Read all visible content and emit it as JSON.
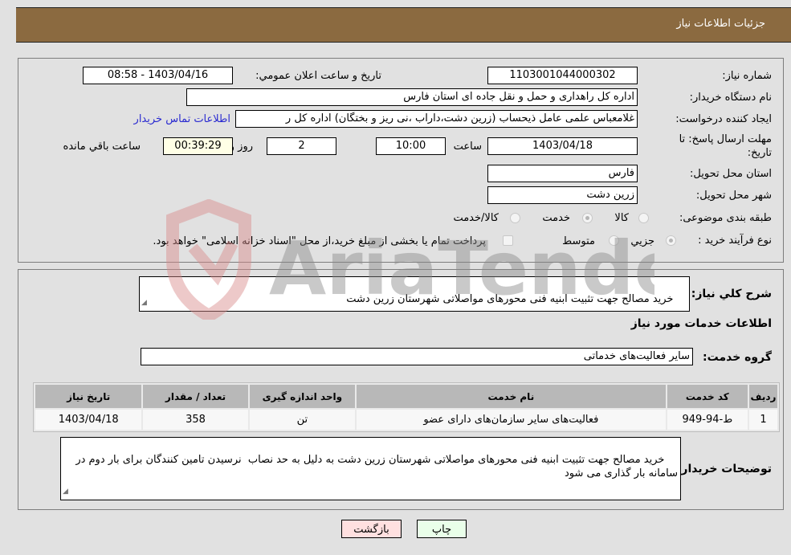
{
  "header": {
    "title": "جزئیات اطلاعات نیاز"
  },
  "info": {
    "need_number_label": "شماره نیاز:",
    "need_number": "1103001044000302",
    "announce_label": "تاریخ و ساعت اعلان عمومي:",
    "announce_value": "1403/04/16 - 08:58",
    "buyer_org_label": "نام دستگاه خریدار:",
    "buyer_org": "اداره کل راهداری و حمل و نقل جاده ای استان فارس",
    "creator_label": "ایجاد کننده درخواست:",
    "creator": "غلامعباس علمی عامل ذیحساب (زرین دشت،داراب ،نی ریز و بختگان) اداره کل ر",
    "contact_link": "اطلاعات تماس خریدار",
    "deadline_label": "مهلت ارسال پاسخ: تا تاریخ:",
    "deadline_date": "1403/04/18",
    "time_label": "ساعت",
    "deadline_time": "10:00",
    "days_value": "2",
    "days_label": "روز و",
    "remaining_time": "00:39:29",
    "remaining_label": "ساعت باقي مانده",
    "province_label": "استان محل تحویل:",
    "province": "فارس",
    "city_label": "شهر محل تحویل:",
    "city": "زرین دشت",
    "category_label": "طبقه بندی موضوعی:",
    "category_options": [
      "کالا",
      "خدمت",
      "کالا/خدمت"
    ],
    "category_selected": "خدمت",
    "process_label": "نوع فرآیند خرید :",
    "process_options": [
      "جزيي",
      "متوسط"
    ],
    "process_selected": "جزيي",
    "payment_note": "پرداخت تمام یا بخشی از مبلغ خرید،از محل \"اسناد خزانه اسلامی\" خواهد بود."
  },
  "details": {
    "summary_label": "شرح کلي نياز:",
    "summary": "خرید مصالح جهت تثبیت ابنیه فنی محورهای مواصلاتی شهرستان زرین دشت",
    "services_heading": "اطلاعات خدمات مورد نیاز",
    "service_group_label": "گروه خدمت:",
    "service_group": "سایر فعالیت‌های خدماتی",
    "table": {
      "headers": [
        "ردیف",
        "کد خدمت",
        "نام خدمت",
        "واحد اندازه گیری",
        "تعداد / مقدار",
        "تاریخ نیاز"
      ],
      "rows": [
        [
          "1",
          "ط-94-949",
          "فعالیت‌های سایر سازمان‌های دارای عضو",
          "تن",
          "358",
          "1403/04/18"
        ]
      ]
    },
    "buyer_notes_label": "توضیحات خریدار:",
    "buyer_notes": "خرید مصالح جهت تثبیت ابنیه فنی محورهای مواصلاتی شهرستان زرین دشت به دلیل به حد نصاب  نرسیدن تامین کنندگان برای بار دوم در سامانه بار گذاری می شود"
  },
  "buttons": {
    "print": "چاپ",
    "back": "بازگشت"
  },
  "watermark": {
    "text": "AriaTender.neT"
  },
  "colors": {
    "header_bg": "#8b6a40",
    "link": "#2a2ad0",
    "back_btn": "#ffe0e0",
    "print_btn": "#e9ffe9",
    "remaining_bg": "#ffffe6"
  }
}
